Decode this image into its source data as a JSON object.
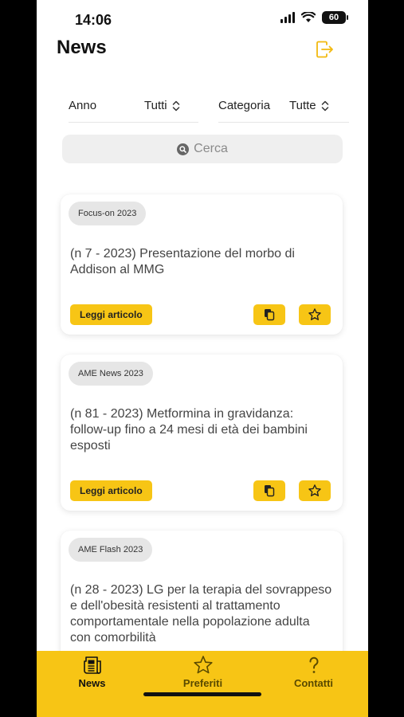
{
  "status_bar": {
    "time": "14:06",
    "battery": "60"
  },
  "header": {
    "title": "News"
  },
  "filters": {
    "year": {
      "label": "Anno",
      "value": "Tutti"
    },
    "category": {
      "label": "Categoria",
      "value": "Tutte"
    }
  },
  "search": {
    "placeholder": "Cerca"
  },
  "articles": [
    {
      "category": "Focus-on 2023",
      "title": "(n 7 - 2023) Presentazione del morbo di Addison al MMG",
      "read_label": "Leggi articolo"
    },
    {
      "category": "AME News 2023",
      "title": "(n 81 - 2023) Metformina in gravidanza: follow-up fino a 24 mesi di età dei bambini esposti",
      "read_label": "Leggi articolo"
    },
    {
      "category": "AME Flash 2023",
      "title": "(n 28 - 2023) LG per la terapia del sovrappeso e dell'obesità resistenti al trattamento comportamentale nella popolazione adulta con comorbilità"
    }
  ],
  "tabs": [
    {
      "label": "News",
      "icon": "newspaper-icon"
    },
    {
      "label": "Preferiti",
      "icon": "star-icon"
    },
    {
      "label": "Contatti",
      "icon": "question-icon"
    }
  ],
  "colors": {
    "accent": "#f7c515",
    "badge_bg": "#e6e6e6"
  }
}
